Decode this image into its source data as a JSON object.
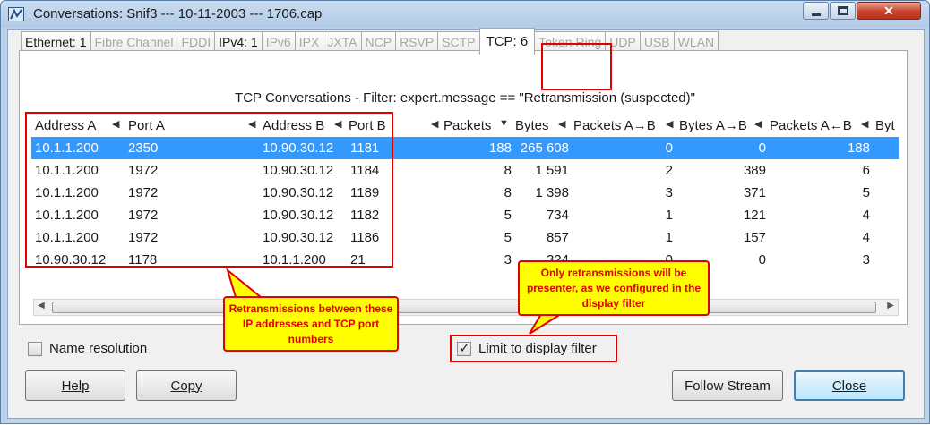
{
  "window": {
    "title": "Conversations: Snif3 --- 10-11-2003 --- 1706.cap"
  },
  "tabs": [
    {
      "label": "Ethernet: 1"
    },
    {
      "label": "Fibre Channel"
    },
    {
      "label": "FDDI"
    },
    {
      "label": "IPv4: 1"
    },
    {
      "label": "IPv6"
    },
    {
      "label": "IPX"
    },
    {
      "label": "JXTA"
    },
    {
      "label": "NCP"
    },
    {
      "label": "RSVP"
    },
    {
      "label": "SCTP"
    },
    {
      "label": "TCP: 6"
    },
    {
      "label": "Token Ring"
    },
    {
      "label": "UDP"
    },
    {
      "label": "USB"
    },
    {
      "label": "WLAN"
    }
  ],
  "panel": {
    "filter_title": "TCP Conversations - Filter: expert.message == \"Retransmission (suspected)\""
  },
  "columns": [
    "Address A",
    "Port A",
    "Address B",
    "Port B",
    "Packets",
    "Bytes",
    "Packets A→B",
    "Bytes A→B",
    "Packets A←B",
    "Byt"
  ],
  "rows": [
    {
      "address_a": "10.1.1.200",
      "port_a": "2350",
      "address_b": "10.90.30.12",
      "port_b": "1181",
      "packets": "188",
      "bytes": "265 608",
      "packets_ab": "0",
      "bytes_ab": "0",
      "packets_ba": "188"
    },
    {
      "address_a": "10.1.1.200",
      "port_a": "1972",
      "address_b": "10.90.30.12",
      "port_b": "1184",
      "packets": "8",
      "bytes": "1 591",
      "packets_ab": "2",
      "bytes_ab": "389",
      "packets_ba": "6"
    },
    {
      "address_a": "10.1.1.200",
      "port_a": "1972",
      "address_b": "10.90.30.12",
      "port_b": "1189",
      "packets": "8",
      "bytes": "1 398",
      "packets_ab": "3",
      "bytes_ab": "371",
      "packets_ba": "5"
    },
    {
      "address_a": "10.1.1.200",
      "port_a": "1972",
      "address_b": "10.90.30.12",
      "port_b": "1182",
      "packets": "5",
      "bytes": "734",
      "packets_ab": "1",
      "bytes_ab": "121",
      "packets_ba": "4"
    },
    {
      "address_a": "10.1.1.200",
      "port_a": "1972",
      "address_b": "10.90.30.12",
      "port_b": "1186",
      "packets": "5",
      "bytes": "857",
      "packets_ab": "1",
      "bytes_ab": "157",
      "packets_ba": "4"
    },
    {
      "address_a": "10.90.30.12",
      "port_a": "1178",
      "address_b": "10.1.1.200",
      "port_b": "21",
      "packets": "3",
      "bytes": "324",
      "packets_ab": "0",
      "bytes_ab": "0",
      "packets_ba": "3"
    }
  ],
  "options": {
    "name_resolution_label": "Name resolution",
    "limit_filter_label": "Limit to display filter",
    "limit_filter_checked": true
  },
  "buttons": {
    "help": "Help",
    "copy": "Copy",
    "follow_stream": "Follow Stream",
    "close": "Close"
  },
  "annotations": {
    "callout_left": "Retransmissions between these IP addresses and TCP port numbers",
    "callout_right": "Only retransmissions will be presenter, as we configured in the display filter"
  },
  "colors": {
    "selection": "#3399ff",
    "highlight_red": "#e00000",
    "callout_yellow": "#ffff00"
  }
}
